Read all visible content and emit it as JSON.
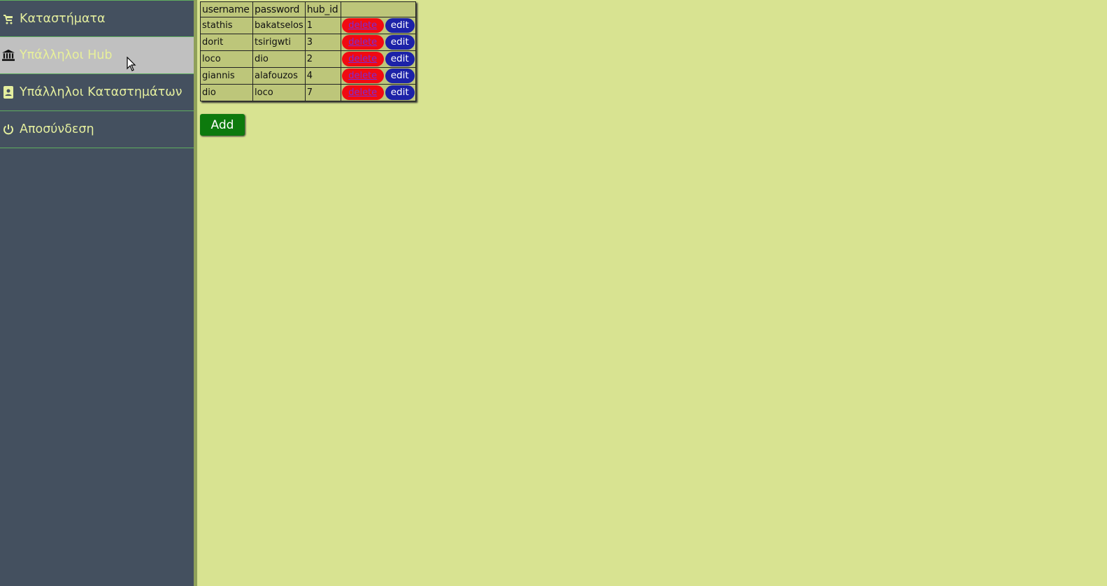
{
  "sidebar": {
    "items": [
      {
        "label": "Καταστήματα",
        "icon": "cart-icon"
      },
      {
        "label": "Υπάλληλοι Hub",
        "icon": "bank-icon"
      },
      {
        "label": "Υπάλληλοι Καταστημάτων",
        "icon": "contact-book-icon"
      },
      {
        "label": "Αποσύνδεση",
        "icon": "power-icon"
      }
    ],
    "active_index": 1
  },
  "table": {
    "headers": [
      "username",
      "password",
      "hub_id",
      ""
    ],
    "rows": [
      {
        "username": "stathis",
        "password": "bakatselos",
        "hub_id": "1"
      },
      {
        "username": "dorit",
        "password": "tsirigwti",
        "hub_id": "3"
      },
      {
        "username": "loco",
        "password": "dio",
        "hub_id": "2"
      },
      {
        "username": "giannis",
        "password": "alafouzos",
        "hub_id": "4"
      },
      {
        "username": "dio",
        "password": "loco",
        "hub_id": "7"
      }
    ],
    "delete_label": "delete",
    "edit_label": "edit"
  },
  "add_label": "Add",
  "colors": {
    "background": "#d8e391",
    "sidebar": "#44505f",
    "delete": "#f10a12",
    "edit": "#1c22a8",
    "add": "#0d7a0d"
  }
}
